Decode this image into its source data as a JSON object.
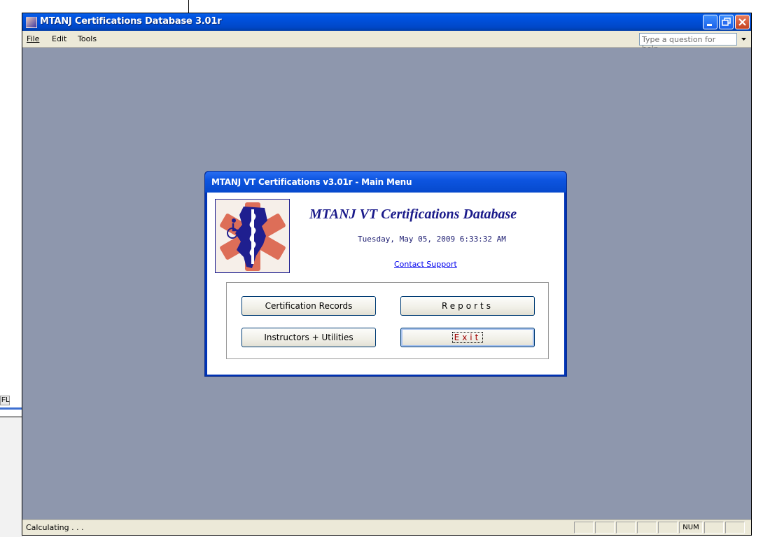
{
  "window": {
    "title": "MTANJ Certifications Database 3.01r"
  },
  "menu": {
    "file": "File",
    "edit": "Edit",
    "tools": "Tools",
    "help_placeholder": "Type a question for help"
  },
  "form": {
    "title": "MTANJ VT Certifications v3.01r - Main Menu",
    "heading": "MTANJ VT Certifications Database",
    "datetime": "Tuesday, May 05, 2009  6:33:32 AM",
    "contact_link": "Contact Support",
    "buttons": {
      "certification_records": "Certification Records",
      "reports": "Reports",
      "instructors_utilities": "Instructors + Utilities",
      "exit": "Exit"
    }
  },
  "statusbar": {
    "text": "Calculating . . .",
    "num": "NUM"
  },
  "background_fragment": {
    "text": "FL"
  },
  "colors": {
    "desktop_bg": "#8e97ad",
    "titlebar_blue": "#0054e3",
    "heading_navy": "#1a1a8a",
    "exit_red": "#a00000"
  }
}
